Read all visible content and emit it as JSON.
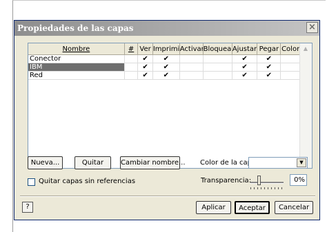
{
  "dialog": {
    "title": "Propiedades de las capas",
    "close_glyph": "×"
  },
  "table": {
    "headers": [
      "Nombre",
      "#",
      "Ver",
      "Imprimir",
      "Activar",
      "Bloquear",
      "Ajustar",
      "Pegar",
      "Color"
    ],
    "rows": [
      {
        "name": "Conector",
        "ver": "✔",
        "imprimir": "✔",
        "ajustar": "✔",
        "pegar": "✔",
        "selected": false
      },
      {
        "name": "IBM",
        "ver": "✔",
        "imprimir": "✔",
        "ajustar": "✔",
        "pegar": "✔",
        "selected": true
      },
      {
        "name": "Red",
        "ver": "✔",
        "imprimir": "✔",
        "ajustar": "✔",
        "pegar": "✔",
        "selected": false
      }
    ]
  },
  "buttons": {
    "nueva": "Nueva...",
    "quitar": "Quitar",
    "cambiar_nombre": "Cambiar nombre...",
    "aplicar": "Aplicar",
    "aceptar": "Aceptar",
    "cancelar": "Cancelar",
    "help": "?"
  },
  "color_capa": {
    "label": "Color de la capa:",
    "value": ""
  },
  "quitar_sin_ref": {
    "label": "Quitar capas sin referencias",
    "checked": false
  },
  "transparencia": {
    "label": "Transparencia:",
    "value": "0%",
    "level": 0
  },
  "icons": {
    "scroll_up": "up-arrow-icon",
    "scroll_down": "down-arrow-icon",
    "combo": "dropdown-arrow-icon"
  }
}
